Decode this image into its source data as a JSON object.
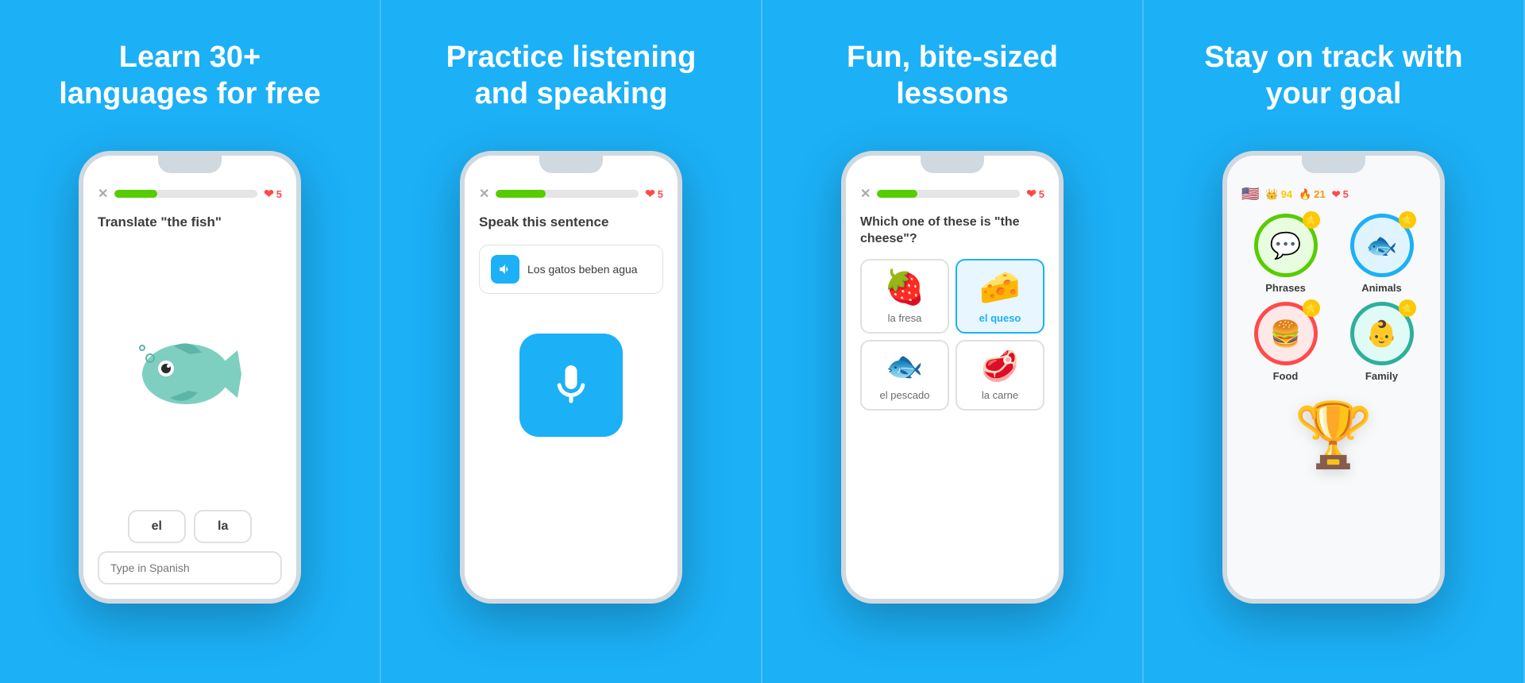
{
  "panels": [
    {
      "id": "panel1",
      "title": "Learn 30+\nlanguages for free",
      "phone": {
        "progress_pct": 30,
        "hearts": "5",
        "question": "Translate \"the fish\"",
        "word_buttons": [
          "el",
          "la"
        ],
        "input_placeholder": "Type in Spanish"
      }
    },
    {
      "id": "panel2",
      "title": "Practice listening\nand speaking",
      "phone": {
        "progress_pct": 35,
        "hearts": "5",
        "question": "Speak this sentence",
        "sentence": "Los gatos beben agua"
      }
    },
    {
      "id": "panel3",
      "title": "Fun, bite-sized\nlessons",
      "phone": {
        "progress_pct": 28,
        "hearts": "5",
        "question": "Which one of these is \"the cheese\"?",
        "options": [
          {
            "emoji": "🍓",
            "label": "la fresa",
            "selected": false
          },
          {
            "emoji": "🧀",
            "label": "el queso",
            "selected": true
          },
          {
            "emoji": "🐟",
            "label": "el pescado",
            "selected": false
          },
          {
            "emoji": "🥩",
            "label": "la carne",
            "selected": false
          }
        ]
      }
    },
    {
      "id": "panel4",
      "title": "Stay on track with\nyour goal",
      "phone": {
        "crown_count": "94",
        "fire_count": "21",
        "hearts": "5",
        "categories": [
          {
            "emoji": "💬",
            "label": "Phrases",
            "style": "green"
          },
          {
            "emoji": "🐟",
            "label": "Animals",
            "style": "blue"
          },
          {
            "emoji": "🍔",
            "label": "Food",
            "style": "red"
          },
          {
            "emoji": "👶",
            "label": "Family",
            "style": "teal"
          }
        ]
      }
    }
  ]
}
